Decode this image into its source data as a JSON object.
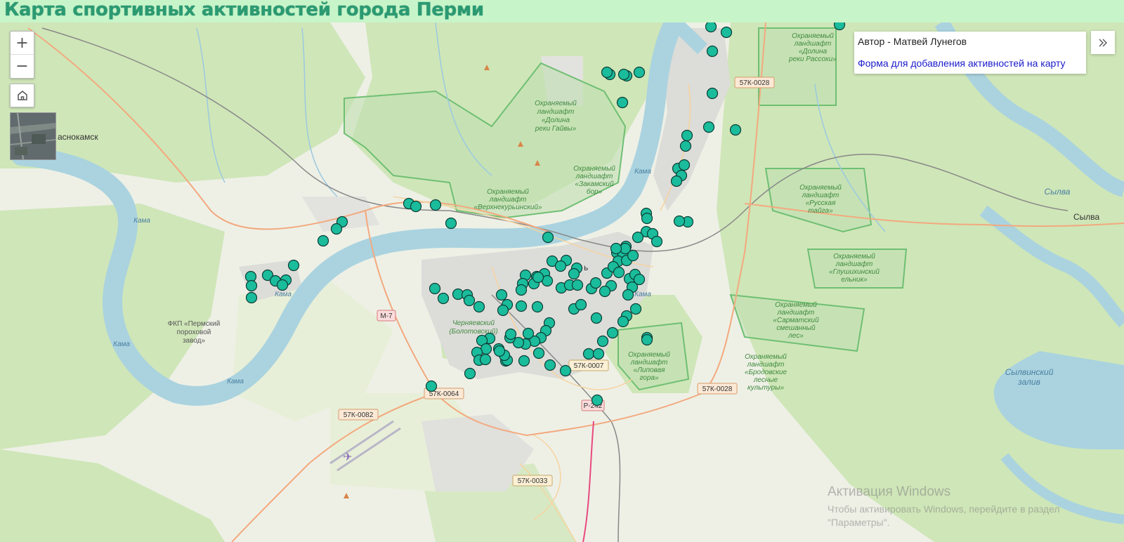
{
  "page": {
    "title": "Карта спортивных активностей города Перми"
  },
  "controls": {
    "zoom_in": "+",
    "zoom_out": "−"
  },
  "info_panel": {
    "author": "Автор - Матвей Лунегов",
    "form_link": "Форма для добавления активностей на карту"
  },
  "watermark": {
    "title": "Активация Windows",
    "text": "Чтобы активировать Windows, перейдите в раздел \"Параметры\"."
  },
  "map": {
    "places": {
      "krasnokamsk": "аснокамск",
      "sylva": "Сылва",
      "perm_fragment": "ь"
    },
    "parks": {
      "gaiva": [
        "Охраняемый",
        "ландшафт",
        "«Долина",
        "реки Гайвы»"
      ],
      "zakamsky": [
        "Охраняемый",
        "ландшафт",
        "«Закамский",
        "бор»"
      ],
      "verkhnekurinsky": [
        "Охраняемый",
        "ландшафт",
        "«Верхнекурьинский»"
      ],
      "rassokha": [
        "Охраняемый",
        "ландшафт",
        "«Долина",
        "реки Рассохи»"
      ],
      "russkaya_taiga": [
        "Охраняемый",
        "ландшафт",
        "«Русская",
        "тайга»"
      ],
      "glushikha": [
        "Охраняемый",
        "ландшафт",
        "«Глушихинский",
        "ельник»"
      ],
      "sarmat": [
        "Охраняемый",
        "ландшафт",
        "«Сарматский",
        "смешанный",
        "лес»"
      ],
      "brodovskie": [
        "Охраняемый",
        "ландшафт",
        "«Бродовские",
        "лесные",
        "культуры»"
      ],
      "lipovaya": [
        "Охраняемый",
        "ландшафт",
        "«Липовая",
        "гора»"
      ],
      "chernyaevsky": [
        "Черняевский",
        "(Болотовский)"
      ],
      "fkp": [
        "ФКП «Пермский",
        "пороховой",
        "завод»"
      ]
    },
    "roads": {
      "r1": "57К-0028",
      "r2": "57К-0028",
      "r3": "М-7",
      "r4": "57К-0064",
      "r5": "57К-0082",
      "r6": "57К-0007",
      "r7": "Р-242",
      "r8": "57К-0033"
    },
    "water": {
      "kama": "Кама",
      "sylva_river": "Сылва",
      "sylvinsky_bay": [
        "Сылвинский",
        "залив"
      ]
    },
    "colors": {
      "marker_fill": "#1abc9c",
      "marker_stroke": "#0d3d34",
      "header_bg": "#c7f5c9",
      "title_color": "#2b9a72",
      "water": "#aad3df",
      "forest": "#c9e3b4",
      "protected_border": "#6fbf73",
      "urban": "#dcdcd8",
      "road_major": "#f3a97e"
    }
  }
}
